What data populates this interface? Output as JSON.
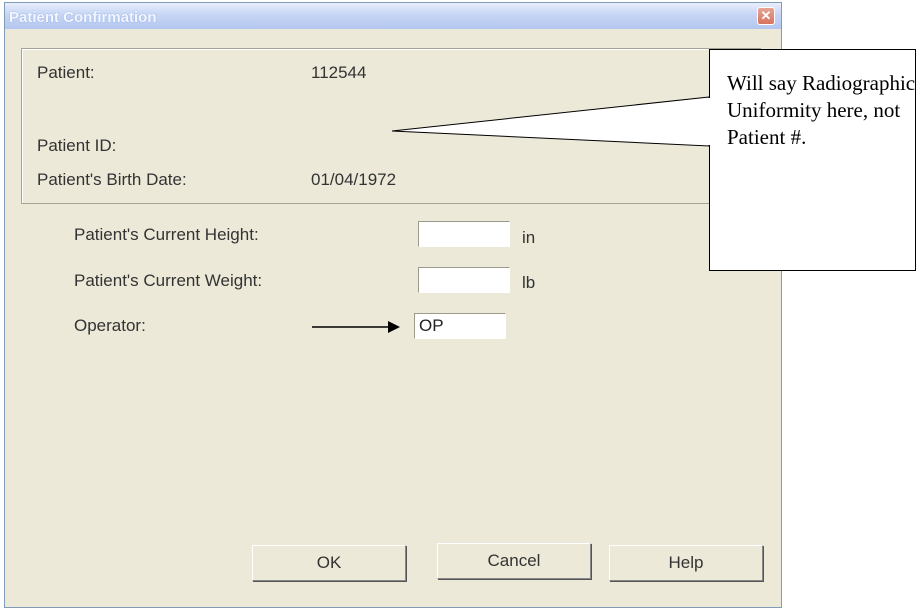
{
  "window": {
    "title": "Patient Confirmation",
    "close_glyph": "✕"
  },
  "patient_info": {
    "patient_label": "Patient:",
    "patient_value": "112544",
    "patient_id_label": "Patient ID:",
    "patient_id_value": "",
    "birth_date_label": "Patient's Birth Date:",
    "birth_date_value": "01/04/1972"
  },
  "form": {
    "height_label": "Patient's Current Height:",
    "height_value": "",
    "height_unit": "in",
    "weight_label": "Patient's Current Weight:",
    "weight_value": "",
    "weight_unit": "lb",
    "operator_label": "Operator:",
    "operator_value": "OP"
  },
  "buttons": {
    "ok": "OK",
    "cancel": "Cancel",
    "help": "Help"
  },
  "annotation": {
    "callout_text": "Will say Radiographic Uniformity here, not Patient #."
  }
}
